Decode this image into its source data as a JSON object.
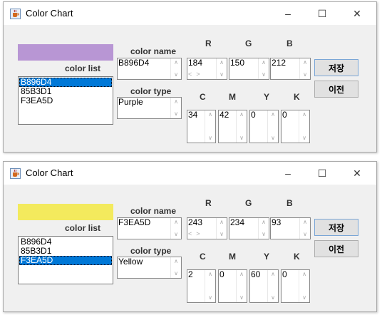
{
  "windows": [
    {
      "title": "Color Chart",
      "swatch_color": "#B896D4",
      "labels": {
        "color_list": "color list",
        "color_name": "color name",
        "color_type": "color type"
      },
      "color_list": {
        "items": [
          "B896D4",
          "85B3D1",
          "F3EA5D"
        ],
        "selected_index": 0
      },
      "color_name": "B896D4",
      "color_type": "Purple",
      "rgb": {
        "R": "184",
        "G": "150",
        "B": "212"
      },
      "cmyk": {
        "C": "34",
        "M": "42",
        "Y": "0",
        "K": "0"
      },
      "buttons": {
        "save": "저장",
        "prev": "이전"
      }
    },
    {
      "title": "Color Chart",
      "swatch_color": "#F3EA5D",
      "labels": {
        "color_list": "color list",
        "color_name": "color name",
        "color_type": "color type"
      },
      "color_list": {
        "items": [
          "B896D4",
          "85B3D1",
          "F3EA5D"
        ],
        "selected_index": 2
      },
      "color_name": "F3EA5D",
      "color_type": "Yellow",
      "rgb": {
        "R": "243",
        "G": "234",
        "B": "93"
      },
      "cmyk": {
        "C": "2",
        "M": "0",
        "Y": "60",
        "K": "0"
      },
      "buttons": {
        "save": "저장",
        "prev": "이전"
      }
    }
  ],
  "channel_labels": {
    "R": "R",
    "G": "G",
    "B": "B",
    "C": "C",
    "M": "M",
    "Y": "Y",
    "K": "K"
  },
  "window_controls": {
    "minimize": "–",
    "maximize": "☐",
    "close": "✕"
  },
  "icons": {
    "app": "java-cup-icon",
    "scroll_up": "chevron-up-icon",
    "scroll_down": "chevron-down-icon"
  }
}
